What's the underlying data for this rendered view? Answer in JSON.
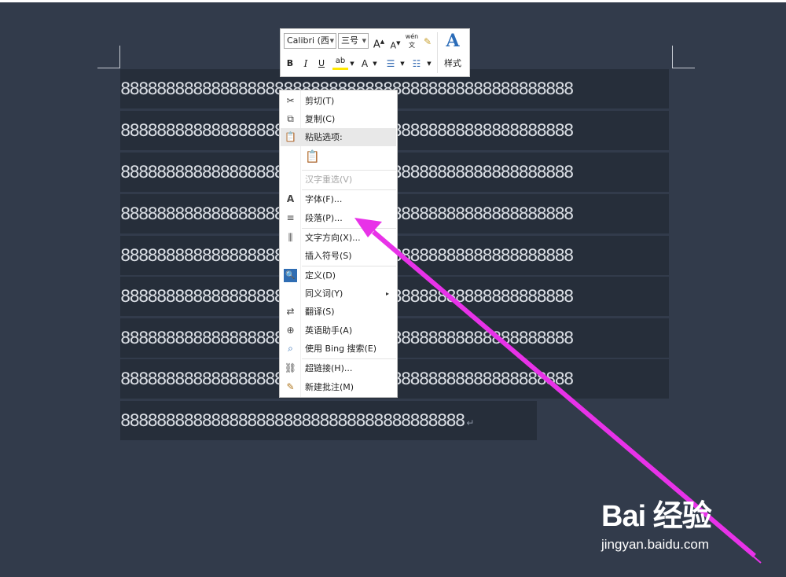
{
  "document": {
    "lines": [
      "88888888888888888888888888888888888888888888888888",
      "88888888888888888888888888888888888888888888888888",
      "88888888888888888888888888888888888888888888888888",
      "88888888888888888888888888888888888888888888888888",
      "88888888888888888888888888888888888888888888888888",
      "88888888888888888888888888888888888888888888888888",
      "88888888888888888888888888888888888888888888888888",
      "88888888888888888888888888888888888888888888888888"
    ],
    "last_line": "88888888888888888888888888888888888888",
    "paragraph_mark": "↵"
  },
  "mini_toolbar": {
    "font_name": "Calibri (西",
    "font_size": "三号",
    "grow_font": "A",
    "shrink_font": "A",
    "phonetic": "wén 文",
    "bold": "B",
    "italic": "I",
    "underline": "U",
    "highlight": "ab",
    "font_color": "A",
    "styles_label": "样式",
    "styles_glyph": "A"
  },
  "context_menu": {
    "items": [
      {
        "label": "剪切(T)",
        "icon": "scissors-icon",
        "glyph": "✂",
        "disabled": false
      },
      {
        "label": "复制(C)",
        "icon": "copy-icon",
        "glyph": "⧉",
        "disabled": false
      },
      {
        "label": "粘贴选项:",
        "icon": "paste-icon",
        "glyph": "📋",
        "disabled": false
      },
      {
        "label": "",
        "icon": "paste-keep-text-icon",
        "glyph": "📋",
        "disabled": false
      },
      {
        "label": "汉字重选(V)",
        "icon": "",
        "glyph": "",
        "disabled": true
      },
      {
        "label": "字体(F)...",
        "icon": "font-icon",
        "glyph": "A",
        "disabled": false
      },
      {
        "label": "段落(P)...",
        "icon": "paragraph-icon",
        "glyph": "≡",
        "disabled": false
      },
      {
        "label": "文字方向(X)...",
        "icon": "text-direction-icon",
        "glyph": "⫼",
        "disabled": false
      },
      {
        "label": "插入符号(S)",
        "icon": "",
        "glyph": "",
        "disabled": false
      },
      {
        "label": "定义(D)",
        "icon": "define-icon",
        "glyph": "🔍",
        "disabled": false
      },
      {
        "label": "同义词(Y)",
        "icon": "",
        "glyph": "",
        "disabled": false
      },
      {
        "label": "翻译(S)",
        "icon": "translate-icon",
        "glyph": "⇄",
        "disabled": false
      },
      {
        "label": "英语助手(A)",
        "icon": "english-assistant-icon",
        "glyph": "⊕",
        "disabled": false
      },
      {
        "label": "使用 Bing 搜索(E)",
        "icon": "bing-search-icon",
        "glyph": "⌕",
        "disabled": false
      },
      {
        "label": "超链接(H)...",
        "icon": "hyperlink-icon",
        "glyph": "⛓",
        "disabled": false
      },
      {
        "label": "新建批注(M)",
        "icon": "new-comment-icon",
        "glyph": "✎",
        "disabled": false
      }
    ],
    "submenu_arrow": "▸"
  },
  "annotation": {
    "arrow_color": "#e832e8"
  },
  "watermark": {
    "logo": "Bai 经验",
    "url": "jingyan.baidu.com"
  }
}
